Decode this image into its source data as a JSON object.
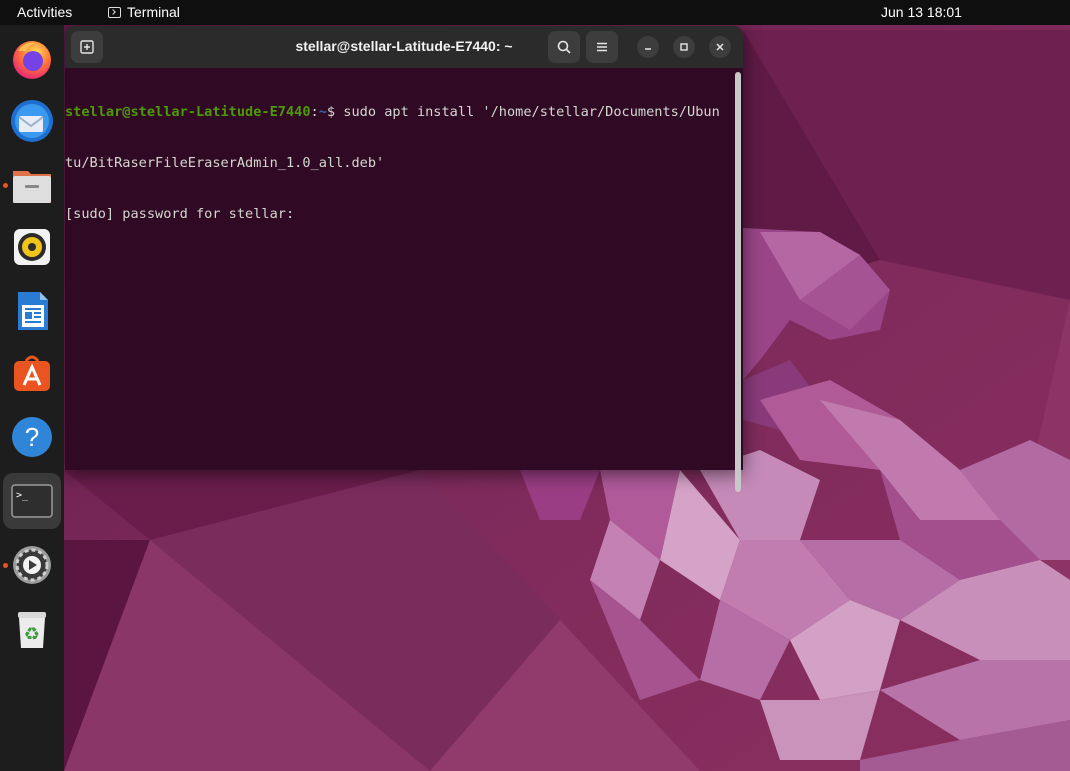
{
  "topbar": {
    "activities_label": "Activities",
    "app_name": "Terminal",
    "clock": "Jun 13  18:01"
  },
  "dock": {
    "items": [
      {
        "name": "Firefox",
        "icon": "firefox-icon"
      },
      {
        "name": "Thunderbird",
        "icon": "thunderbird-icon"
      },
      {
        "name": "Files",
        "icon": "files-icon",
        "running": true
      },
      {
        "name": "Rhythmbox",
        "icon": "rhythmbox-icon"
      },
      {
        "name": "LibreOffice Writer",
        "icon": "writer-icon"
      },
      {
        "name": "Ubuntu Software",
        "icon": "software-icon"
      },
      {
        "name": "Help",
        "icon": "help-icon"
      },
      {
        "name": "Terminal",
        "icon": "terminal-icon",
        "running": true,
        "active": true
      },
      {
        "name": "Settings",
        "icon": "settings-icon",
        "running": true
      },
      {
        "name": "Trash",
        "icon": "trash-icon"
      }
    ]
  },
  "terminal": {
    "title": "stellar@stellar-Latitude-E7440: ~",
    "prompt_user": "stellar@stellar-Latitude-E7440",
    "prompt_sep": ":",
    "prompt_path": "~",
    "prompt_symbol": "$ ",
    "command_part1": "sudo apt install '/home/stellar/Documents/Ubun",
    "command_part2": "tu/BitRaserFileEraserAdmin_1.0_all.deb'",
    "sudo_prompt": "[sudo] password for stellar: "
  },
  "colors": {
    "terminal_bg": "#300a24",
    "prompt_user": "#4e9a06",
    "prompt_path": "#3465a4",
    "accent": "#e95420"
  }
}
